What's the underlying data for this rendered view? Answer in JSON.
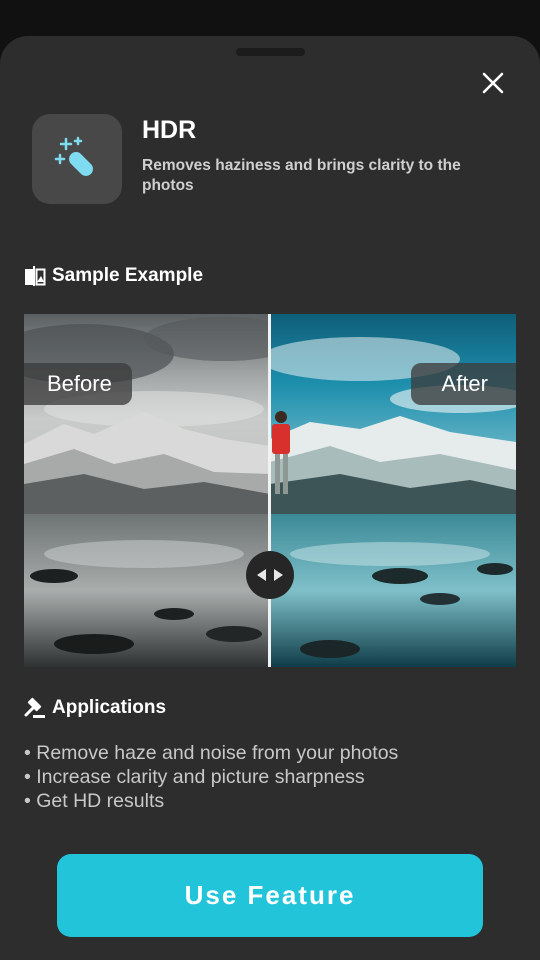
{
  "feature": {
    "title": "HDR",
    "description": "Removes haziness and brings clarity to the photos",
    "icon": "magic-wand-icon"
  },
  "sample": {
    "heading": "Sample Example",
    "icon": "compare-icon",
    "before_label": "Before",
    "after_label": "After",
    "slider_position": 0.5
  },
  "applications": {
    "heading": "Applications",
    "icon": "gavel-icon",
    "items": [
      "Remove haze and noise from your photos",
      "Increase clarity and picture sharpness",
      "Get HD results"
    ]
  },
  "cta": {
    "label": "Use Feature"
  },
  "colors": {
    "accent": "#22c4da",
    "sheet_bg": "#2d2d2d",
    "backdrop": "#111111"
  }
}
